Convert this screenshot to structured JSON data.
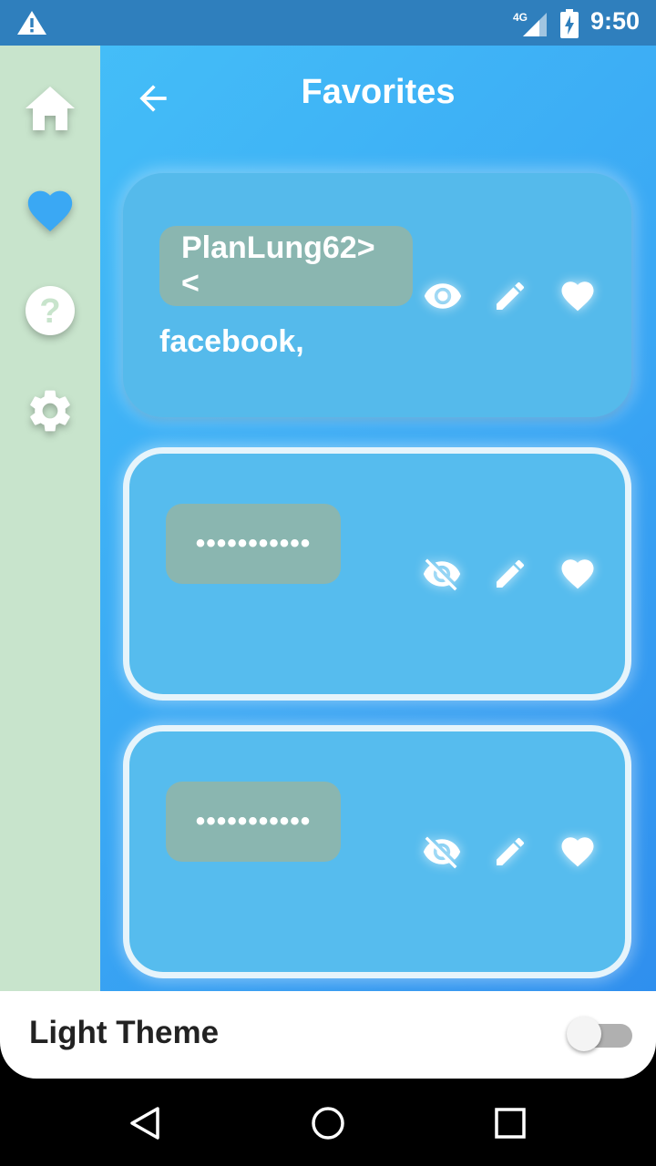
{
  "status_bar": {
    "time": "9:50",
    "network": "4G",
    "icons": [
      "warning-icon",
      "signal-icon",
      "battery-charging-icon"
    ]
  },
  "rail": {
    "items": [
      {
        "icon": "home-icon",
        "active": false
      },
      {
        "icon": "heart-icon",
        "active": true
      },
      {
        "icon": "help-icon",
        "active": false
      },
      {
        "icon": "gear-icon",
        "active": false
      }
    ]
  },
  "header": {
    "title": "Favorites",
    "back_icon": "arrow-back-icon"
  },
  "cards": [
    {
      "password": "PlanLung62><",
      "site": "facebook,",
      "visible": true,
      "favorite": true
    },
    {
      "password": "•••••••••••",
      "site": "",
      "visible": false,
      "favorite": true
    },
    {
      "password": "•••••••••••",
      "site": "",
      "visible": false,
      "favorite": true
    }
  ],
  "theme": {
    "label": "Light Theme",
    "enabled": false
  },
  "nav": {
    "icons": [
      "back-triangle-icon",
      "home-circle-icon",
      "recents-square-icon"
    ]
  },
  "colors": {
    "accent": "#3aa8f4",
    "rail": "#c8e4cc",
    "chip": "#8ab6b0",
    "card": "#56bcee"
  }
}
